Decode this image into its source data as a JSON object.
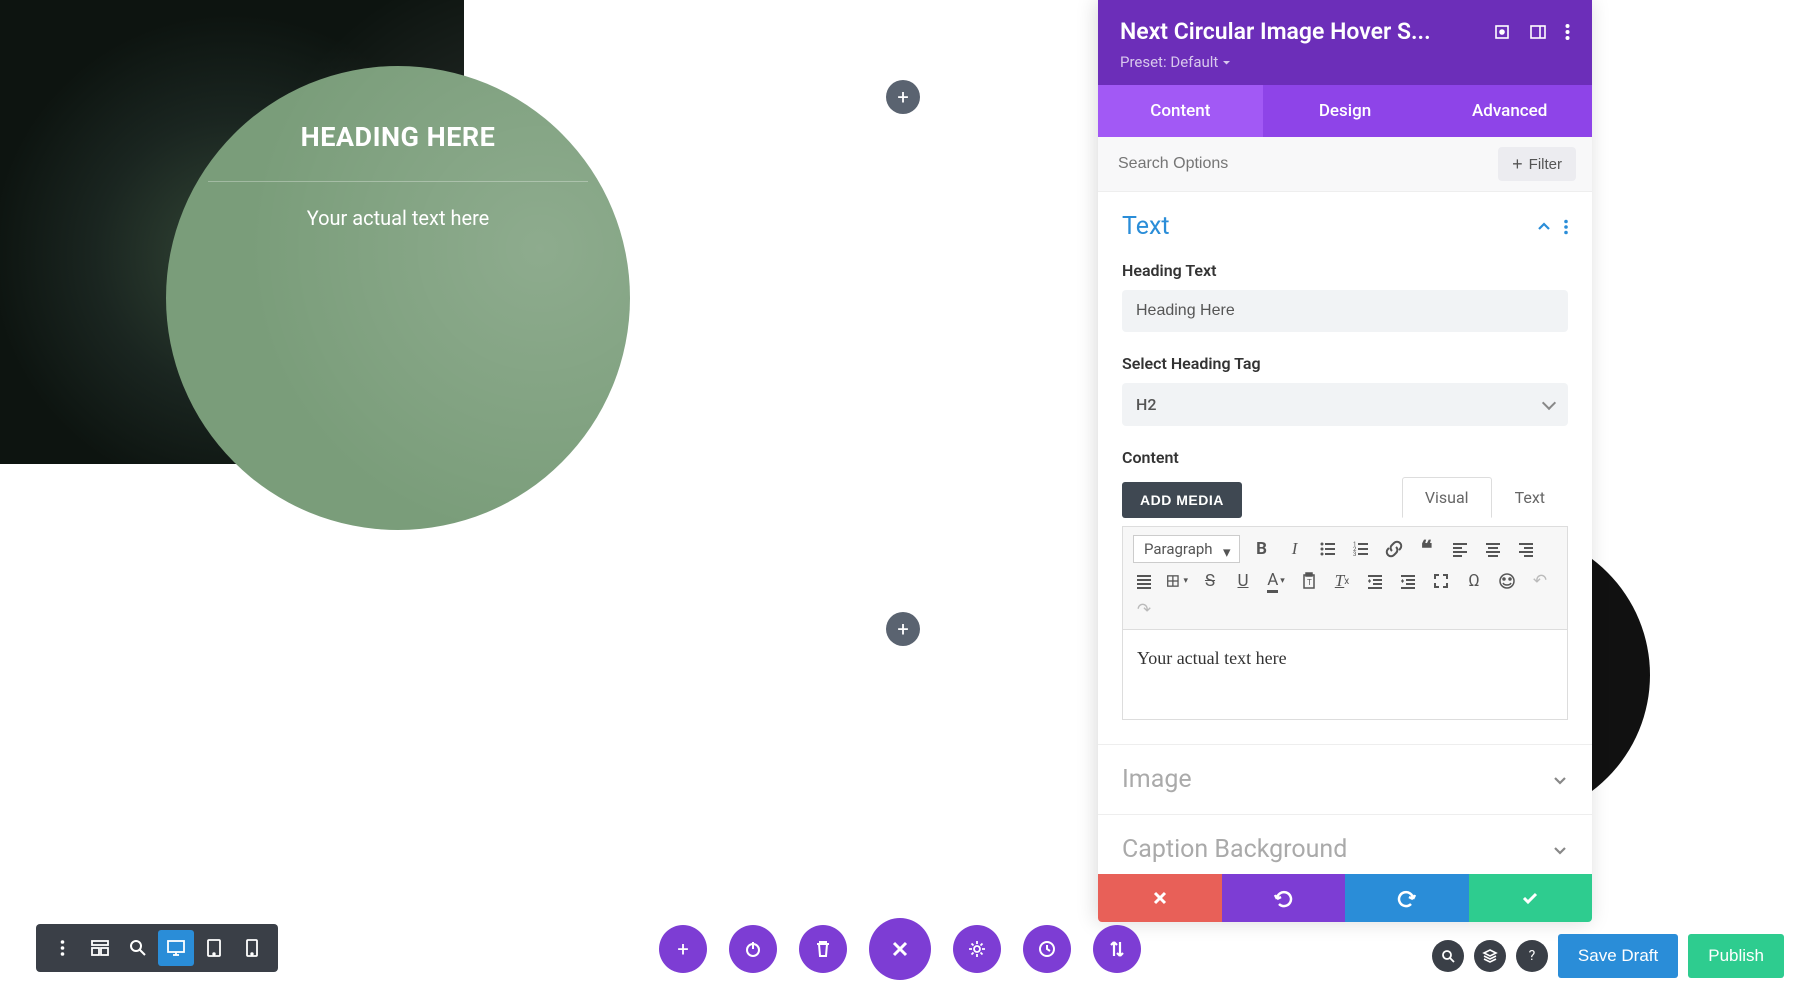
{
  "canvas": {
    "circle1": {
      "heading": "HEADING HERE",
      "text": "Your actual text here"
    }
  },
  "addButtons": {
    "plus": "+"
  },
  "panel": {
    "title": "Next Circular Image Hover S...",
    "presetLabel": "Preset:",
    "presetValue": "Default",
    "tabs": {
      "content": "Content",
      "design": "Design",
      "advanced": "Advanced"
    },
    "searchPlaceholder": "Search Options",
    "filterLabel": "Filter",
    "sections": {
      "text": "Text",
      "image": "Image",
      "captionBg": "Caption Background"
    },
    "fields": {
      "headingTextLabel": "Heading Text",
      "headingTextValue": "Heading Here",
      "selectTagLabel": "Select Heading Tag",
      "selectTagValue": "H2",
      "contentLabel": "Content",
      "addMedia": "ADD MEDIA",
      "visualTab": "Visual",
      "textTab": "Text",
      "paragraph": "Paragraph",
      "editorContent": "Your actual text here"
    }
  },
  "bottomRight": {
    "saveDraft": "Save Draft",
    "publish": "Publish"
  }
}
